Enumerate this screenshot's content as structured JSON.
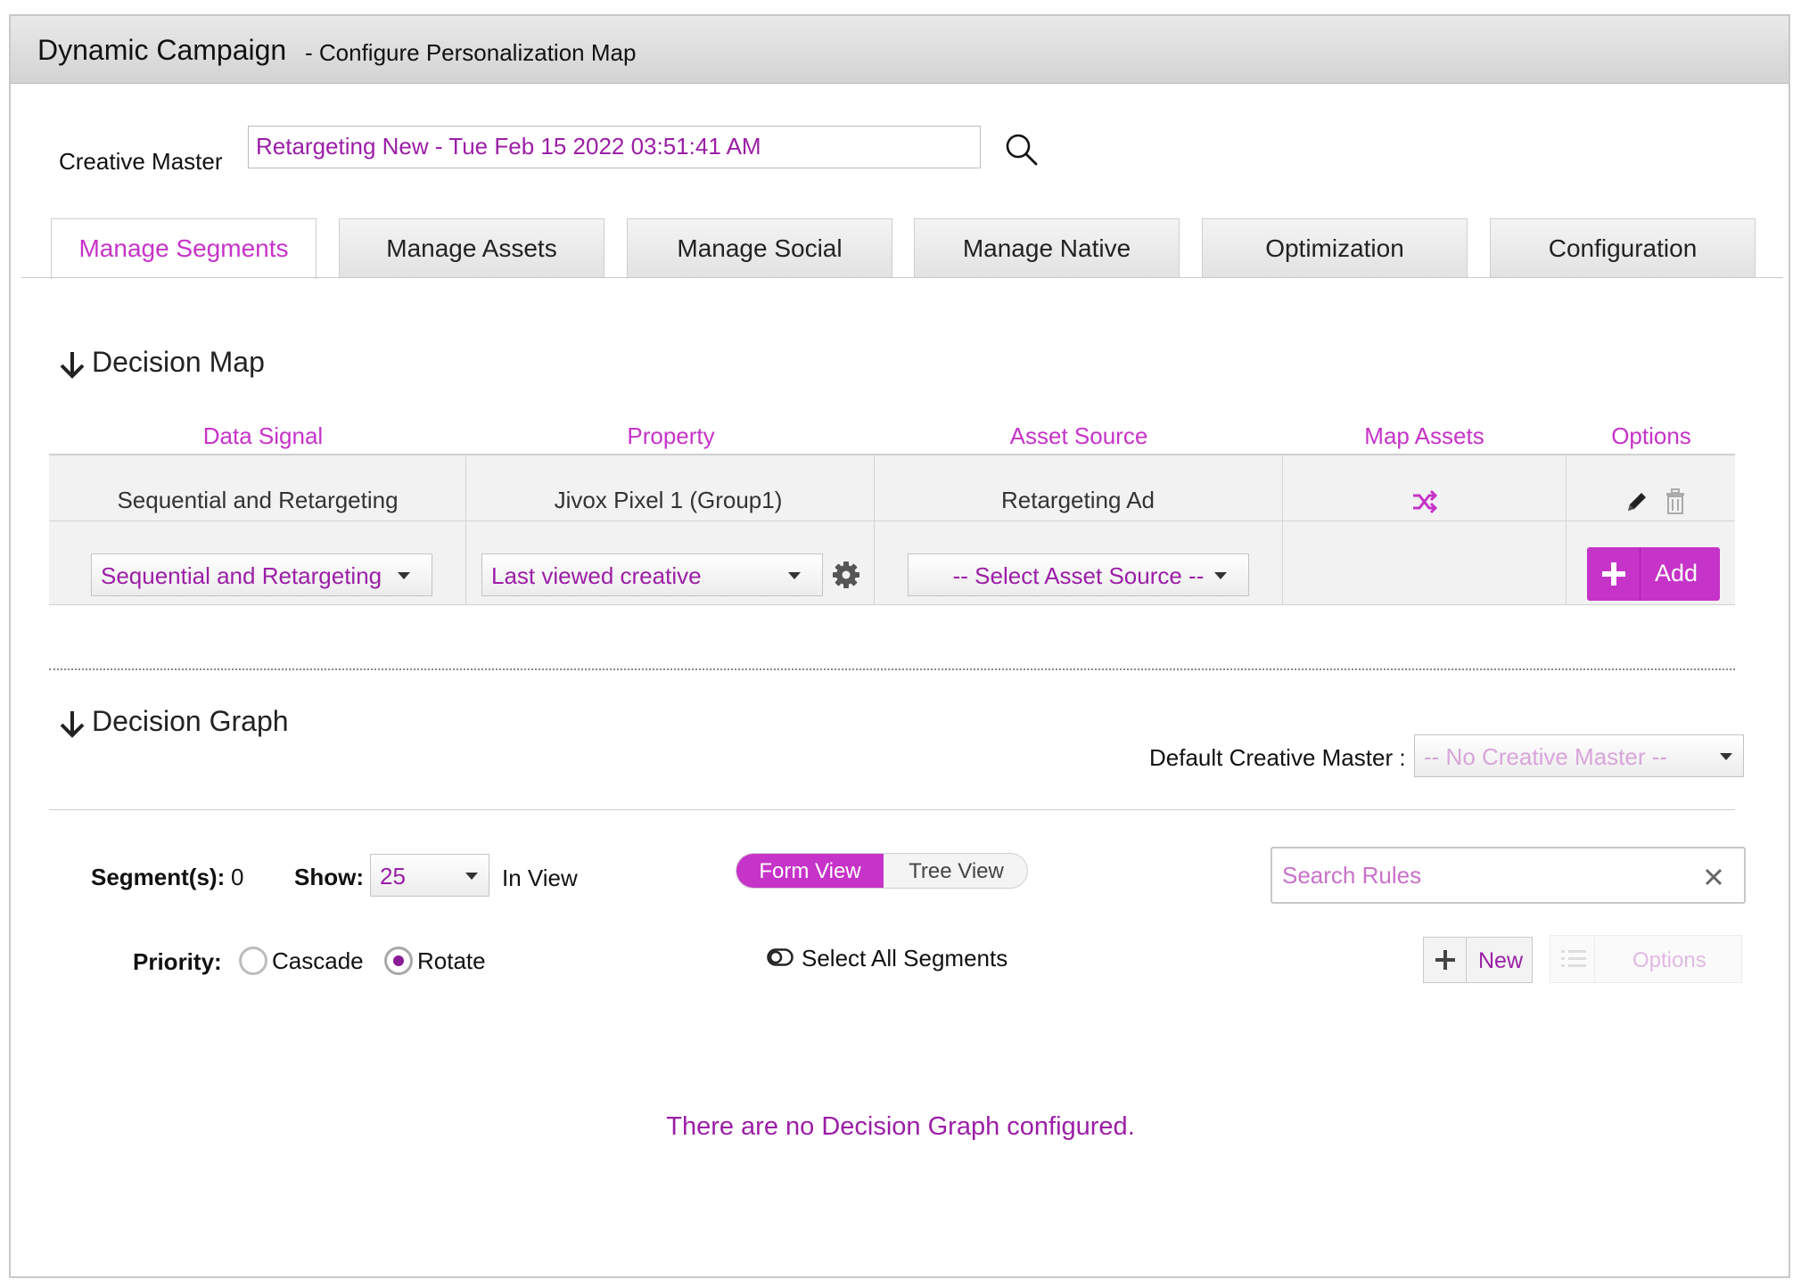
{
  "window": {
    "title": "Dynamic Campaign",
    "subtitle": "- Configure Personalization Map"
  },
  "creative_master": {
    "label": "Creative Master",
    "value": "Retargeting New - Tue Feb 15 2022 03:51:41 AM",
    "search_icon": "search-icon"
  },
  "tabs": [
    {
      "label": "Manage Segments",
      "active": true
    },
    {
      "label": "Manage Assets",
      "active": false
    },
    {
      "label": "Manage Social",
      "active": false
    },
    {
      "label": "Manage Native",
      "active": false
    },
    {
      "label": "Optimization",
      "active": false
    },
    {
      "label": "Configuration",
      "active": false
    }
  ],
  "decision_map": {
    "title": "Decision Map",
    "columns": [
      "Data Signal",
      "Property",
      "Asset Source",
      "Map Assets",
      "Options"
    ],
    "row": {
      "data_signal": "Sequential and Retargeting",
      "property": "Jivox Pixel 1 (Group1)",
      "asset_source": "Retargeting Ad",
      "map_assets_icon": "shuffle-icon",
      "option_icons": [
        "pencil-icon",
        "trash-icon"
      ]
    },
    "new_row": {
      "data_signal_select": "Sequential and Retargeting",
      "property_select": "Last viewed creative",
      "asset_source_select": "-- Select Asset Source --",
      "settings_icon": "gear-icon",
      "add_label": "Add"
    }
  },
  "decision_graph": {
    "title": "Decision Graph",
    "default_master_label": "Default Creative Master :",
    "default_master_value": "-- No Creative Master --",
    "segments_label": "Segment(s):",
    "segments_count": "0",
    "show_label": "Show:",
    "show_value": "25",
    "in_view_label": "In View",
    "view_toggle": {
      "form": "Form View",
      "tree": "Tree View",
      "selected": "Form View"
    },
    "search_placeholder": "Search Rules",
    "priority_label": "Priority:",
    "priority_options": [
      "Cascade",
      "Rotate"
    ],
    "priority_selected": "Rotate",
    "select_all_label": "Select All Segments",
    "new_label": "New",
    "options_label": "Options",
    "empty_message": "There are no Decision Graph configured."
  },
  "colors": {
    "accent": "#c633c8",
    "accent_text": "#9b1ea6",
    "title_bar": "#dcdcdc"
  }
}
